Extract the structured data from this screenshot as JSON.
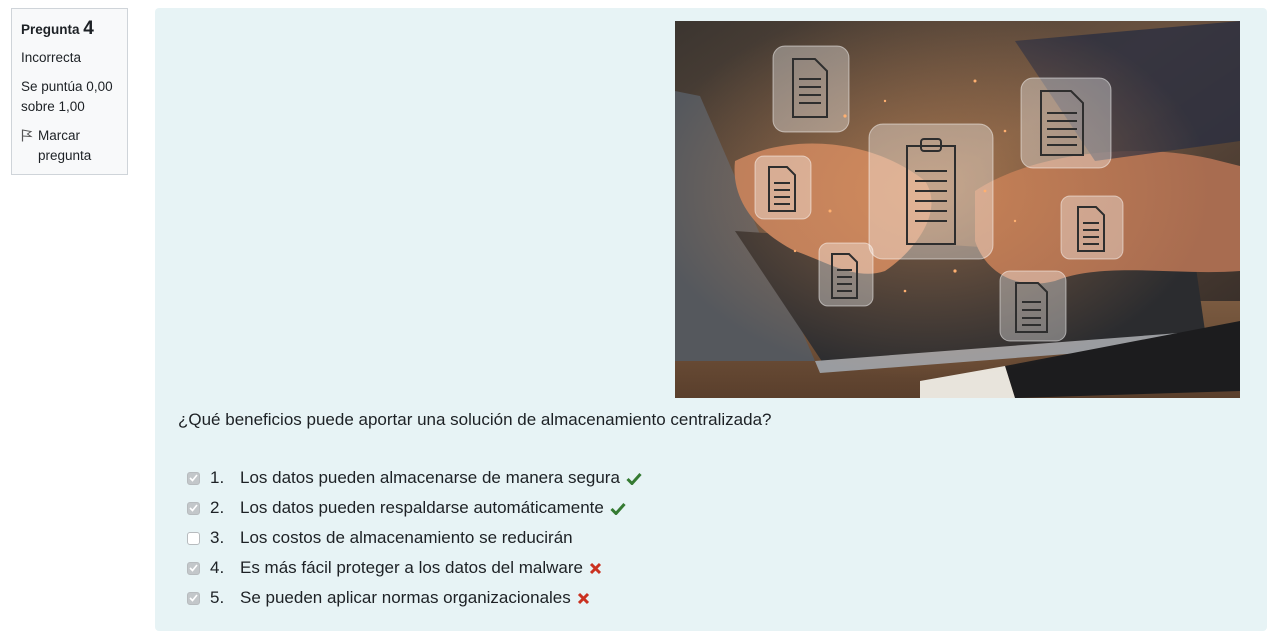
{
  "question_info": {
    "prefix": "Pregunta",
    "number": "4",
    "state": "Incorrecta",
    "grade_line1": "Se puntúa 0,00",
    "grade_line2": "sobre 1,00",
    "flag_line1": "Marcar",
    "flag_line2": "pregunta"
  },
  "question": {
    "text": "¿Qué beneficios puede aportar una solución de almacenamiento centralizada?",
    "image_alt": "Manos escribiendo en un portátil con iconos de documentos flotantes"
  },
  "answers": [
    {
      "number": "1.",
      "text": "Los datos pueden almacenarse de manera segura",
      "checked": true,
      "result": "correct-icon"
    },
    {
      "number": "2.",
      "text": "Los datos pueden respaldarse automáticamente",
      "checked": true,
      "result": "correct-icon"
    },
    {
      "number": "3.",
      "text": "Los costos de almacenamiento se reducirán",
      "checked": false,
      "result": "none"
    },
    {
      "number": "4.",
      "text": "Es más fácil proteger a los datos del malware",
      "checked": true,
      "result": "incorrect-icon"
    },
    {
      "number": "5.",
      "text": "Se pueden aplicar normas organizacionales",
      "checked": true,
      "result": "incorrect-icon"
    }
  ],
  "colors": {
    "panel_bg": "#e7f3f5",
    "correct": "#357a32",
    "incorrect": "#ca3120"
  }
}
